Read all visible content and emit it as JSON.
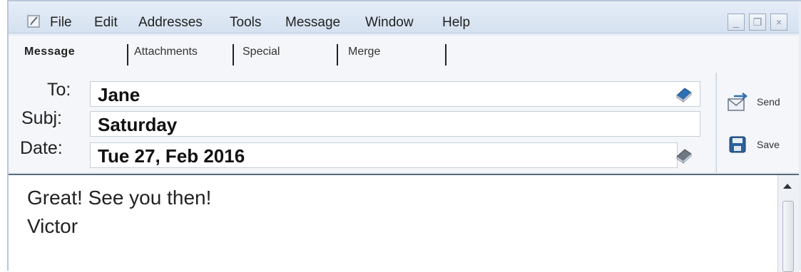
{
  "menubar": {
    "items": [
      "File",
      "Edit",
      "Addresses",
      "Tools",
      "Message",
      "Window",
      "Help"
    ],
    "icon": "compose-icon"
  },
  "window_controls": {
    "minimize": "_",
    "restore": "❐",
    "close": "×"
  },
  "tabs": [
    "Message",
    "Attachments",
    "Special",
    "Merge"
  ],
  "fields": {
    "to": {
      "label": "To:",
      "value": "Jane"
    },
    "subj": {
      "label": "Subj:",
      "value": "Saturday"
    },
    "date": {
      "label": "Date:",
      "value": "Tue 27, Feb 2016"
    }
  },
  "actions": {
    "send": "Send",
    "save": "Save"
  },
  "body": {
    "lines": [
      "Great! See you then!",
      "Victor"
    ]
  },
  "colors": {
    "menubar": "#d5e1f0",
    "address_book": "#2f6fb3"
  }
}
